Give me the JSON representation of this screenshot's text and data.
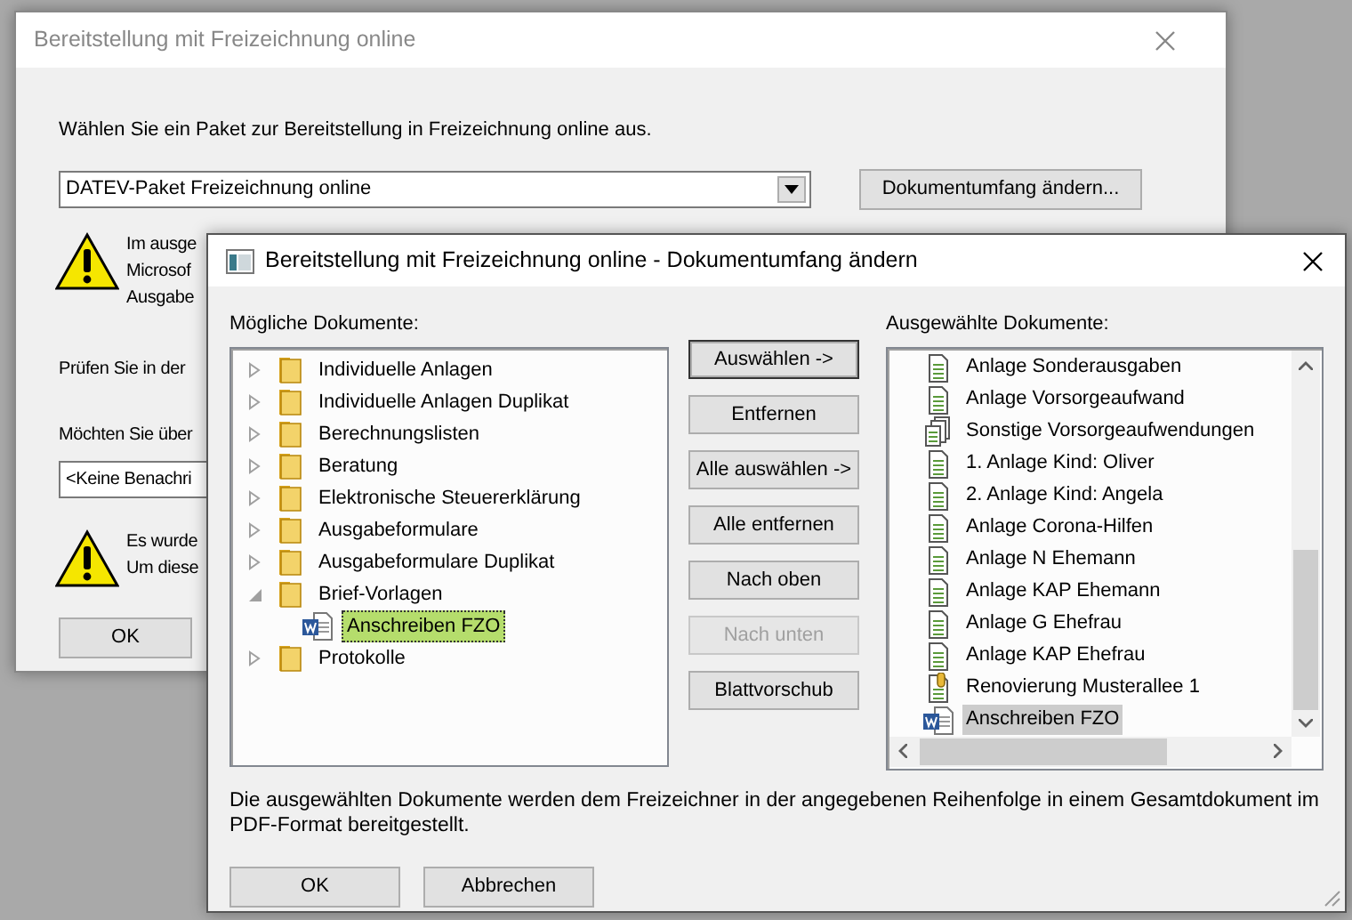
{
  "background_window": {
    "title": "Bereitstellung mit Freizeichnung online",
    "prompt": "Wählen Sie ein Paket zur Bereitstellung in Freizeichnung online aus.",
    "package_select": {
      "value": "DATEV-Paket Freizeichnung online"
    },
    "scope_button": "Dokumentumfang ändern...",
    "warning_1_lines": [
      "Im ausge",
      "Microsof",
      "Ausgabe"
    ],
    "check_text": "Prüfen Sie in der",
    "question_text": "Möchten Sie über",
    "notification_select": {
      "value": "<Keine Benachri"
    },
    "warning_2_lines": [
      "Es wurde",
      "Um diese"
    ],
    "ok_button": "OK"
  },
  "dialog": {
    "title": "Bereitstellung mit Freizeichnung online - Dokumentumfang ändern",
    "available_label": "Mögliche Dokumente:",
    "tree": [
      {
        "label": "Individuelle Anlagen",
        "kind": "folder",
        "expanded": false,
        "selected": false
      },
      {
        "label": "Individuelle Anlagen Duplikat",
        "kind": "folder",
        "expanded": false,
        "selected": false
      },
      {
        "label": "Berechnungslisten",
        "kind": "folder",
        "expanded": false,
        "selected": false
      },
      {
        "label": "Beratung",
        "kind": "folder",
        "expanded": false,
        "selected": false
      },
      {
        "label": "Elektronische Steuererklärung",
        "kind": "folder",
        "expanded": false,
        "selected": false
      },
      {
        "label": "Ausgabeformulare",
        "kind": "folder",
        "expanded": false,
        "selected": false
      },
      {
        "label": "Ausgabeformulare Duplikat",
        "kind": "folder",
        "expanded": false,
        "selected": false
      },
      {
        "label": "Brief-Vorlagen",
        "kind": "folder",
        "expanded": true,
        "selected": false,
        "children": [
          {
            "label": "Anschreiben FZO",
            "kind": "word",
            "selected": true
          }
        ]
      },
      {
        "label": "Protokolle",
        "kind": "folder",
        "expanded": false,
        "selected": false
      }
    ],
    "buttons": [
      {
        "label": "Auswählen ->",
        "disabled": false,
        "default": true
      },
      {
        "label": "Entfernen",
        "disabled": false,
        "default": false
      },
      {
        "label": "Alle auswählen ->",
        "disabled": false,
        "default": false
      },
      {
        "label": "Alle entfernen",
        "disabled": false,
        "default": false
      },
      {
        "label": "Nach oben",
        "disabled": false,
        "default": false
      },
      {
        "label": "Nach unten",
        "disabled": true,
        "default": false
      },
      {
        "label": "Blattvorschub",
        "disabled": false,
        "default": false
      }
    ],
    "selected_label": "Ausgewählte Dokumente:",
    "selected_documents": [
      {
        "label": "Anlage Sonderausgaben",
        "kind": "document",
        "selected": false
      },
      {
        "label": "Anlage Vorsorgeaufwand",
        "kind": "document",
        "selected": false
      },
      {
        "label": "Sonstige Vorsorgeaufwendungen",
        "kind": "group",
        "selected": false
      },
      {
        "label": "1. Anlage Kind: Oliver",
        "kind": "document",
        "selected": false
      },
      {
        "label": "2. Anlage Kind: Angela",
        "kind": "document",
        "selected": false
      },
      {
        "label": "Anlage Corona-Hilfen",
        "kind": "document",
        "selected": false
      },
      {
        "label": "Anlage N Ehemann",
        "kind": "document",
        "selected": false
      },
      {
        "label": "Anlage KAP Ehemann",
        "kind": "document",
        "selected": false
      },
      {
        "label": "Anlage G Ehefrau",
        "kind": "document",
        "selected": false
      },
      {
        "label": "Anlage KAP Ehefrau",
        "kind": "document",
        "selected": false
      },
      {
        "label": "Renovierung Musterallee 1",
        "kind": "attachment",
        "selected": false
      },
      {
        "label": "Anschreiben FZO",
        "kind": "word",
        "selected": true
      }
    ],
    "note": "Die ausgewählten Dokumente werden dem Freizeichner in der angegebenen Reihenfolge in einem Gesamtdokument im PDF-Format bereitgestellt.",
    "ok_button": "OK",
    "cancel_button": "Abbrechen"
  }
}
